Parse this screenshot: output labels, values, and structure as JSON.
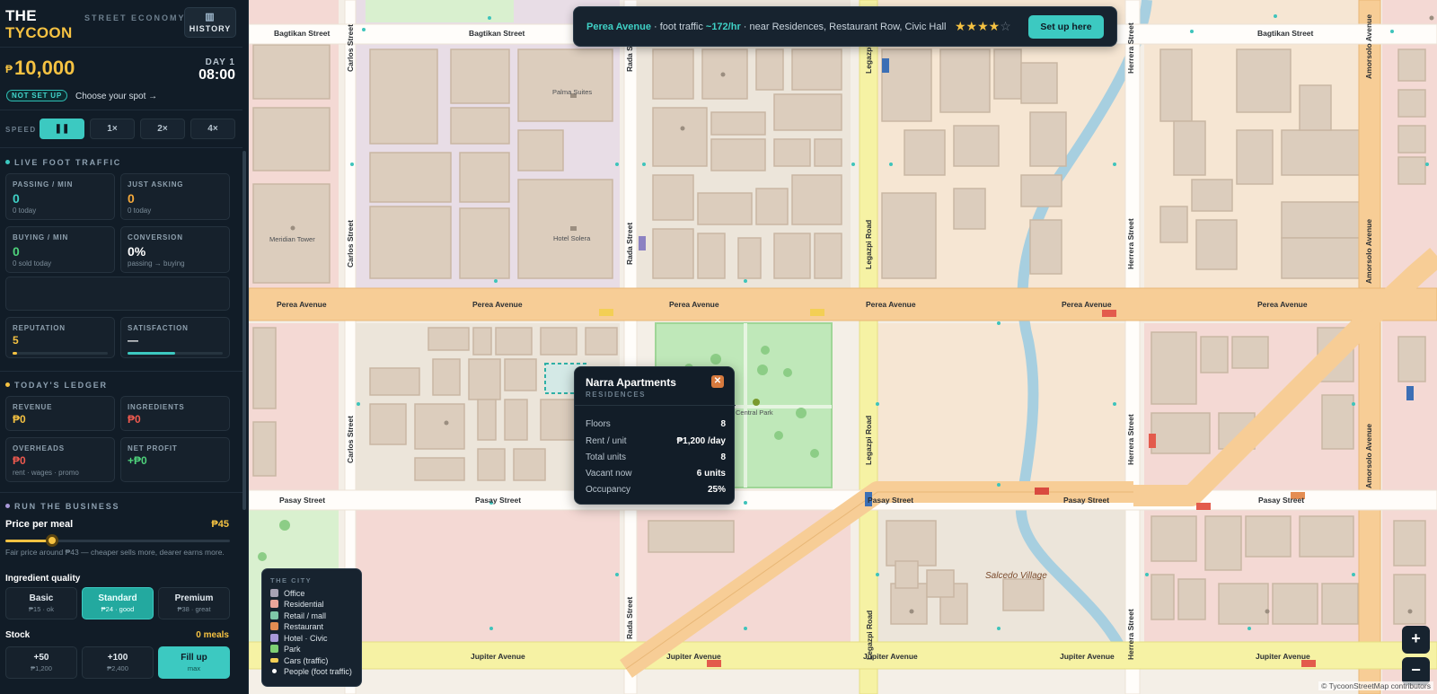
{
  "brand": {
    "line1": "THE",
    "line2": "TYCOON",
    "tagline": "STREET ECONOMY",
    "history_label": "HISTORY"
  },
  "status": {
    "money_symbol": "₱",
    "money": "10,000",
    "day": "DAY 1",
    "time": "08:00",
    "badge": "NOT SET UP",
    "hint": "Choose your spot →"
  },
  "speed": {
    "label": "SPEED",
    "options": [
      "❚❚",
      "1×",
      "2×",
      "4×"
    ],
    "active": 0
  },
  "foot_traffic": {
    "title": "LIVE FOOT TRAFFIC",
    "passing": {
      "label": "PASSING / MIN",
      "value": "0",
      "sub": "0 today"
    },
    "asking": {
      "label": "JUST ASKING",
      "value": "0",
      "sub": "0 today"
    },
    "buying": {
      "label": "BUYING / MIN",
      "value": "0",
      "sub": "0 sold today"
    },
    "conversion": {
      "label": "CONVERSION",
      "value": "0%",
      "sub": "passing → buying"
    },
    "reputation": {
      "label": "REPUTATION",
      "value": "5",
      "fill": 0.05
    },
    "satisfaction": {
      "label": "SATISFACTION",
      "value": "—",
      "fill": 0.5
    }
  },
  "ledger": {
    "title": "TODAY'S LEDGER",
    "revenue": {
      "label": "REVENUE",
      "value": "₱0"
    },
    "ingredients": {
      "label": "INGREDIENTS",
      "value": "₱0"
    },
    "overheads": {
      "label": "OVERHEADS",
      "value": "₱0",
      "sub": "rent · wages · promo"
    },
    "net_profit": {
      "label": "NET PROFIT",
      "value": "+₱0"
    }
  },
  "business": {
    "title": "RUN THE BUSINESS",
    "price_label": "Price per meal",
    "price_value": "₱45",
    "price_level": 0.2,
    "price_hint": "Fair price around ₱43 — cheaper sells more, dearer earns more.",
    "quality_label": "Ingredient quality",
    "tiers": [
      {
        "name": "Basic",
        "detail": "₱15 · ok"
      },
      {
        "name": "Standard",
        "detail": "₱24 · good"
      },
      {
        "name": "Premium",
        "detail": "₱38 · great"
      }
    ],
    "active_tier": 1,
    "stock_label": "Stock",
    "stock_value": "0 meals",
    "stock_buttons": [
      {
        "name": "+50",
        "detail": "₱1,200"
      },
      {
        "name": "+100",
        "detail": "₱2,400"
      },
      {
        "name": "Fill up",
        "detail": "max"
      }
    ]
  },
  "banner": {
    "location": "Perea Avenue",
    "sep1": " · foot traffic ",
    "traffic": "~172/hr",
    "sep2": " · near Residences, Restaurant Row, Civic Hall",
    "stars_on": "★★★★",
    "stars_off": "☆",
    "rating": 4,
    "button": "Set up here"
  },
  "popup": {
    "title": "Narra Apartments",
    "subtitle": "RESIDENCES",
    "close": "✕",
    "rows": [
      {
        "label": "Floors",
        "value": "8"
      },
      {
        "label": "Rent / unit",
        "value": "₱1,200 /day"
      },
      {
        "label": "Total units",
        "value": "8"
      },
      {
        "label": "Vacant now",
        "value": "6 units"
      },
      {
        "label": "Occupancy",
        "value": "25%"
      }
    ]
  },
  "legend": {
    "title": "THE CITY",
    "items": [
      {
        "label": "Office",
        "color": "#a7a2b3"
      },
      {
        "label": "Residential",
        "color": "#e9a59a"
      },
      {
        "label": "Retail / mall",
        "color": "#7fc7a8"
      },
      {
        "label": "Restaurant",
        "color": "#e48d52"
      },
      {
        "label": "Hotel · Civic",
        "color": "#a898d8"
      },
      {
        "label": "Park",
        "color": "#7fcf74"
      },
      {
        "label": "Cars (traffic)",
        "color": "#f3cf55"
      },
      {
        "label": "People (foot traffic)",
        "color": "#ffffff"
      }
    ]
  },
  "map": {
    "roads_h": [
      {
        "name": "Bagtikan Street",
        "labels": [
          "Bagtikan Street",
          "Bagtikan Street",
          "Bagtikan Street"
        ]
      },
      {
        "name": "Perea Avenue",
        "labels": [
          "Perea Avenue",
          "Perea Avenue",
          "Perea Avenue",
          "Perea Avenue",
          "Perea Avenue",
          "Perea Avenue"
        ]
      },
      {
        "name": "Pasay Street",
        "labels": [
          "Pasay Street",
          "Pasay Street",
          "Pasay Street",
          "Pasay Street",
          "Pasay Street"
        ]
      },
      {
        "name": "Jupiter Avenue",
        "labels": [
          "Jupiter Avenue",
          "Jupiter Avenue",
          "Jupiter Avenue",
          "Jupiter Avenue",
          "Jupiter Avenue",
          "Jupiter Avenue"
        ]
      }
    ],
    "roads_v": {
      "carlos": "Carlos Street",
      "rada": "Rada Street",
      "legazpi": "Legazpi Road",
      "herrera": "Herrera Street",
      "amorsolo": "Amorsolo Avenue"
    },
    "pois": {
      "palma": "Palma Suites",
      "meridian": "Meridian Tower",
      "solera": "Hotel Solera",
      "central_park": "Central Park",
      "salcedo": "Salcedo Village"
    },
    "zoom_in": "+",
    "zoom_out": "−",
    "attribution": "© TycoonStreetMap contributors"
  }
}
